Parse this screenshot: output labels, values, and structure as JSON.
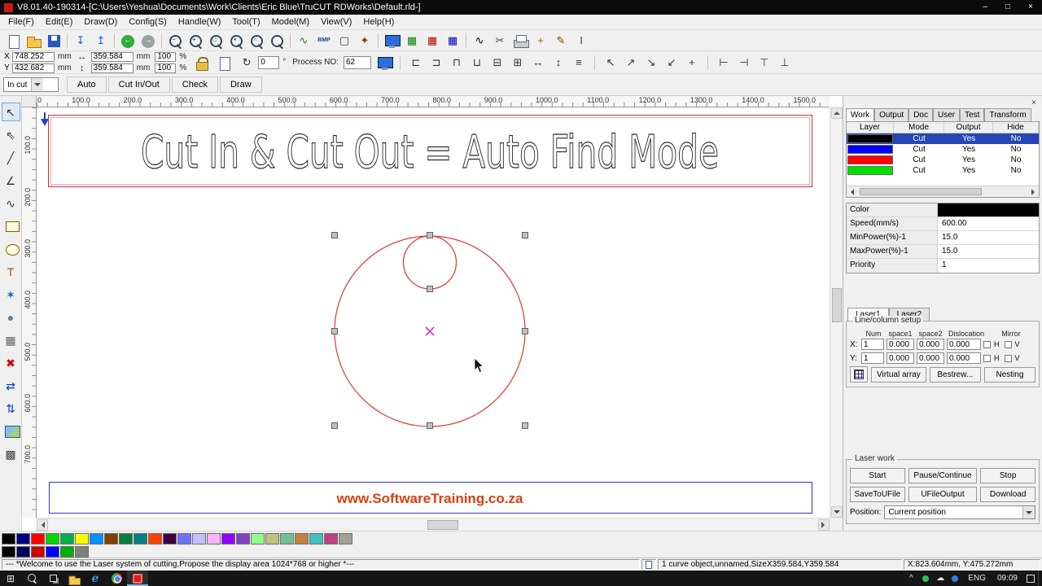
{
  "window": {
    "title": "V8.01.40-190314-[C:\\Users\\Yeshua\\Documents\\Work\\Clients\\Eric Blue\\TruCUT RDWorks\\Default.rld-]",
    "controls": {
      "minimize": "–",
      "maximize": "□",
      "close": "×"
    }
  },
  "menu": {
    "items": [
      "File(F)",
      "Edit(E)",
      "Draw(D)",
      "Config(S)",
      "Handle(W)",
      "Tool(T)",
      "Model(M)",
      "View(V)",
      "Help(H)"
    ]
  },
  "toolbar1": {
    "icons": [
      {
        "name": "new-file-icon",
        "shape": "page"
      },
      {
        "name": "open-file-icon",
        "shape": "folder"
      },
      {
        "name": "save-file-icon",
        "shape": "floppy"
      },
      {
        "sep": true
      },
      {
        "name": "import-icon",
        "glyph": "↧",
        "color": "#2060c0"
      },
      {
        "name": "export-icon",
        "glyph": "↥",
        "color": "#2060c0"
      },
      {
        "sep": true
      },
      {
        "name": "undo-icon",
        "shape": "circle-green",
        "glyph": "←"
      },
      {
        "name": "redo-icon",
        "shape": "circle-gray",
        "glyph": "→"
      },
      {
        "sep": true
      },
      {
        "name": "zoom-out-icon",
        "shape": "magnifier",
        "sub": "−"
      },
      {
        "name": "zoom-in-icon",
        "shape": "magnifier",
        "sub": "+"
      },
      {
        "name": "zoom-window-icon",
        "shape": "magnifier",
        "sub": "□"
      },
      {
        "name": "zoom-all-icon",
        "shape": "magnifier",
        "sub": "▪"
      },
      {
        "name": "zoom-select-icon",
        "shape": "magnifier",
        "sub": "▫"
      },
      {
        "name": "pan-view-icon",
        "shape": "magnifier",
        "sub": ""
      },
      {
        "sep": true
      },
      {
        "name": "curve-smooth-icon",
        "glyph": "∿",
        "color": "#208020"
      },
      {
        "name": "bmp-icon",
        "text": "BMP"
      },
      {
        "name": "rect-select-icon",
        "glyph": "▢",
        "color": "#333333"
      },
      {
        "name": "node-edit-icon",
        "glyph": "✦",
        "color": "#804000"
      },
      {
        "sep": true
      },
      {
        "name": "preview-monitor-icon",
        "shape": "monitor"
      },
      {
        "name": "array-output-icon",
        "glyph": "▦",
        "color": "#008000"
      },
      {
        "name": "array-copy-icon",
        "glyph": "▦",
        "color": "#c00000"
      },
      {
        "name": "array-virtual-icon",
        "glyph": "▦",
        "color": "#0000c0"
      },
      {
        "sep": true
      },
      {
        "name": "wave-icon",
        "glyph": "∿",
        "color": "#000000"
      },
      {
        "name": "cut-preview-icon",
        "glyph": "✂",
        "color": "#404040"
      },
      {
        "name": "print-icon",
        "shape": "printer"
      },
      {
        "name": "laser-position-icon",
        "glyph": "+",
        "color": "#a06000"
      },
      {
        "name": "pen-icon",
        "glyph": "✎",
        "color": "#804000"
      },
      {
        "name": "measure-icon",
        "glyph": "I",
        "color": "#404040"
      }
    ]
  },
  "toolbar2": {
    "x_label": "X",
    "x_value": "748.252",
    "x_unit": "mm",
    "y_label": "Y",
    "y_value": "432.682",
    "y_unit": "mm",
    "width_glyph": "↔",
    "height_glyph": "↕",
    "w_value": "359.584",
    "w_unit": "mm",
    "h_value": "359.584",
    "h_unit": "mm",
    "w_pct": "100",
    "h_pct": "100",
    "pct_sign": "%",
    "rotate_glyph": "↻",
    "angle_value": "0",
    "angle_unit": "°",
    "process_label": "Process NO:",
    "process_value": "62",
    "align_icons": [
      {
        "name": "align-left-icon",
        "glyph": "⊏"
      },
      {
        "name": "align-right-icon",
        "glyph": "⊐"
      },
      {
        "name": "align-top-icon",
        "glyph": "⊓"
      },
      {
        "name": "align-bottom-icon",
        "glyph": "⊔"
      },
      {
        "name": "align-center-h-icon",
        "glyph": "⊟"
      },
      {
        "name": "align-center-v-icon",
        "glyph": "⊞"
      },
      {
        "name": "same-width-icon",
        "glyph": "↔"
      },
      {
        "name": "same-height-icon",
        "glyph": "↕"
      },
      {
        "name": "distribute-icon",
        "glyph": "≡"
      }
    ],
    "arrow_icons": [
      {
        "name": "move-top-left-icon",
        "glyph": "↖"
      },
      {
        "name": "move-top-right-icon",
        "glyph": "↗"
      },
      {
        "name": "move-bottom-right-icon",
        "glyph": "↘"
      },
      {
        "name": "move-bottom-left-icon",
        "glyph": "↙"
      },
      {
        "name": "move-center-icon",
        "glyph": "+"
      }
    ],
    "end_icons": [
      {
        "name": "flip-left-icon",
        "glyph": "⊢"
      },
      {
        "name": "flip-right-icon",
        "glyph": "⊣"
      },
      {
        "name": "flip-top-icon",
        "glyph": "⊤"
      },
      {
        "name": "flip-bottom-icon",
        "glyph": "⊥"
      }
    ]
  },
  "mode_bar": {
    "selector_value": "In cut",
    "buttons": [
      "Auto",
      "Cut In/Out",
      "Check",
      "Draw"
    ]
  },
  "left_tools": {
    "icons": [
      {
        "name": "select-tool-icon",
        "glyph": "↖",
        "pressed": true
      },
      {
        "name": "node-edit-tool-icon",
        "glyph": "⇖"
      },
      {
        "name": "line-tool-icon",
        "glyph": "╱"
      },
      {
        "name": "polyline-tool-icon",
        "glyph": "∠"
      },
      {
        "name": "curve-tool-icon",
        "glyph": "∿"
      },
      {
        "name": "rectangle-tool-icon",
        "shape": "rect-tool"
      },
      {
        "name": "ellipse-tool-icon",
        "shape": "ellipse-tool"
      },
      {
        "name": "text-tool-icon",
        "glyph": "T",
        "color": "#c04000"
      },
      {
        "name": "star-tool-icon",
        "glyph": "✶",
        "color": "#0060c0"
      },
      {
        "name": "fill-tool-icon",
        "glyph": "●",
        "color": "#6080a0"
      },
      {
        "name": "grid-tool-icon",
        "glyph": "▦",
        "color": "#606060"
      },
      {
        "name": "delete-tool-icon",
        "glyph": "✖",
        "color": "#d00000"
      },
      {
        "name": "mirror-horizontal-icon",
        "glyph": "⇄",
        "color": "#0040c0"
      },
      {
        "name": "mirror-vertical-icon",
        "glyph": "⇅",
        "color": "#0040c0"
      },
      {
        "name": "image-tool-icon",
        "shape": "photo"
      },
      {
        "name": "array-tool-icon",
        "glyph": "▩",
        "color": "#404040"
      }
    ]
  },
  "canvas": {
    "ruler_top": [
      "0",
      "100.0",
      "200.0",
      "300.0",
      "400.0",
      "500.0",
      "600.0",
      "700.0",
      "800.0",
      "900.0",
      "1000.0",
      "1100.0",
      "1200.0",
      "1300.0",
      "1400.0",
      "1500.0"
    ],
    "ruler_left": [
      "100.0",
      "200.0",
      "300.0",
      "400.0",
      "500.0",
      "600.0",
      "700.0"
    ],
    "headline": "Cut In & Cut Out = Auto Find Mode",
    "footer": "www.SoftwareTraining.co.za"
  },
  "right_panel": {
    "close_label": "×",
    "tabs": [
      {
        "label": "Work",
        "selected": true
      },
      {
        "label": "Output"
      },
      {
        "label": "Doc"
      },
      {
        "label": "User"
      },
      {
        "label": "Test"
      },
      {
        "label": "Transform"
      }
    ],
    "layer_table": {
      "headers": [
        "Layer",
        "Mode",
        "Output",
        "Hide"
      ],
      "rows": [
        {
          "color": "#000000",
          "mode": "Cut",
          "output": "Yes",
          "hide": "No",
          "selected": true
        },
        {
          "color": "#0000ff",
          "mode": "Cut",
          "output": "Yes",
          "hide": "No",
          "selected": false
        },
        {
          "color": "#ff0000",
          "mode": "Cut",
          "output": "Yes",
          "hide": "No",
          "selected": false
        },
        {
          "color": "#00e000",
          "mode": "Cut",
          "output": "Yes",
          "hide": "No",
          "selected": false
        }
      ]
    },
    "properties": [
      {
        "label": "Color",
        "value": "",
        "swatch": "#000000"
      },
      {
        "label": "Speed(mm/s)",
        "value": "600.00"
      },
      {
        "label": "MinPower(%)-1",
        "value": "15.0"
      },
      {
        "label": "MaxPower(%)-1",
        "value": "15.0"
      },
      {
        "label": "Priority",
        "value": "1"
      }
    ],
    "laser_tabs": [
      {
        "label": "Laser1",
        "selected": true
      },
      {
        "label": "Laser2"
      }
    ],
    "line_column": {
      "title": "Line/column setup",
      "col_headers": [
        "Num",
        "space1",
        "space2",
        "Dislocation",
        "Mirror"
      ],
      "x_label": "X:",
      "y_label": "Y:",
      "x": {
        "num": "1",
        "space1": "0.000",
        "space2": "0.000",
        "dislocation": "0.000"
      },
      "y": {
        "num": "1",
        "space1": "0.000",
        "space2": "0.000",
        "dislocation": "0.000"
      },
      "mirror_h_label": "H",
      "mirror_v_label": "V",
      "buttons": [
        "Virtual array",
        "Bestrew...",
        "Nesting"
      ]
    },
    "laser_work": {
      "title": "Laser work",
      "row1": [
        "Start",
        "Pause/Continue",
        "Stop"
      ],
      "row2": [
        "SaveToUFile",
        "UFileOutput",
        "Download"
      ],
      "position_label": "Position:",
      "position_value": "Current position"
    }
  },
  "palette": {
    "row1": [
      "#000000",
      "#000080",
      "#ff0000",
      "#00d800",
      "#00b050",
      "#ffff00",
      "#0090ff",
      "#804000",
      "#008040",
      "#008080",
      "#ff4000",
      "#400040",
      "#7070ff",
      "#c0c0ff",
      "#ffb0ff",
      "#9000ff",
      "#8040c0",
      "#90ff90",
      "#c0c080",
      "#70c090",
      "#c08040",
      "#40c0c0",
      "#c04080",
      "#a0a098"
    ],
    "row2": [
      "#000000",
      "#000060",
      "#d00000",
      "#0000ff",
      "#00b000",
      "#808080"
    ]
  },
  "status_bar": {
    "message": "--- *Welcome to use the Laser system of cutting,Propose the display area 1024*768 or higher *---",
    "selection": "1 curve object,unnamed,SizeX359.584,Y359.584",
    "coords": "X:823.604mm, Y:475.272mm"
  },
  "taskbar": {
    "start_glyph": "⊞",
    "edge_glyph": "e",
    "chevron": "^",
    "cloud_glyph": "☁",
    "language": "ENG",
    "time": "09:09"
  }
}
